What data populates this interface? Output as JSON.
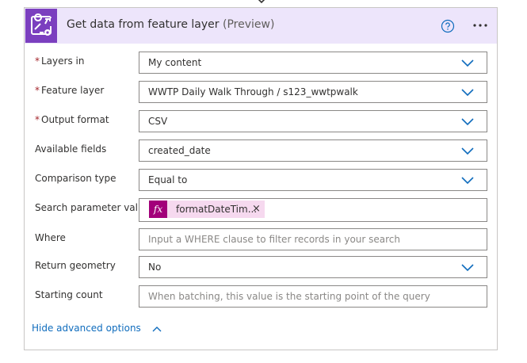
{
  "header": {
    "title": "Get data from feature layer",
    "preview": "(Preview)",
    "icons": {
      "app": "map-route-icon",
      "help": "help-icon",
      "more": "more-icon"
    }
  },
  "form": {
    "layers_in": {
      "label": "Layers in",
      "required": true,
      "value": "My content"
    },
    "feature_layer": {
      "label": "Feature layer",
      "required": true,
      "value": "WWTP Daily Walk Through / s123_wwtpwalk"
    },
    "output_format": {
      "label": "Output format",
      "required": true,
      "value": "CSV"
    },
    "available_fields": {
      "label": "Available fields",
      "value": "created_date"
    },
    "comparison_type": {
      "label": "Comparison type",
      "value": "Equal to"
    },
    "search_parameter": {
      "label": "Search parameter value",
      "token": "formatDateTim...",
      "token_icon": "fx"
    },
    "where": {
      "label": "Where",
      "placeholder": "Input a WHERE clause to filter records in your search"
    },
    "return_geometry": {
      "label": "Return geometry",
      "value": "No"
    },
    "starting_count": {
      "label": "Starting count",
      "placeholder": "When batching, this value is the starting point of the query"
    }
  },
  "advanced_toggle": "Hide advanced options",
  "colors": {
    "header_bg": "#ede5fb",
    "app_icon_bg": "#7b3fbf",
    "accent": "#0f6cbd",
    "token_bg": "#f6d9ef",
    "fx_bg": "#a2007a",
    "required": "#a4262c"
  }
}
